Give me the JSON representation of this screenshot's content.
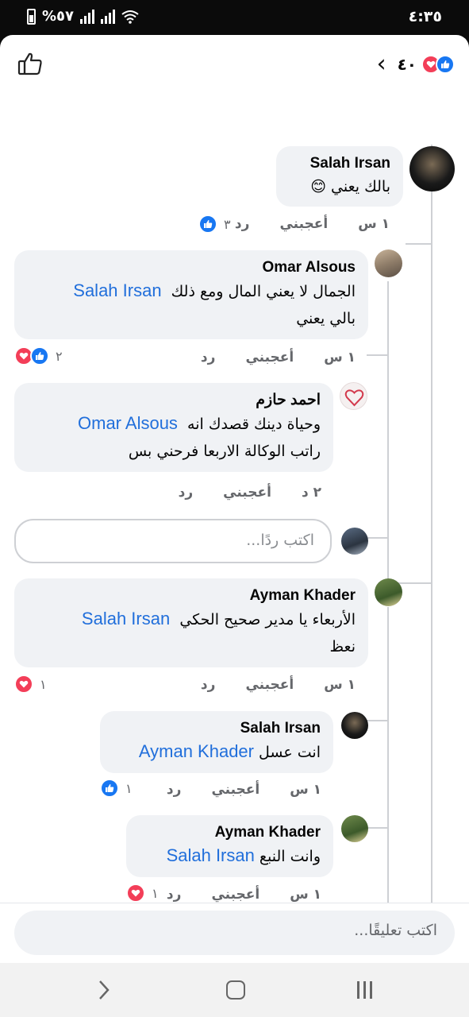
{
  "status_bar": {
    "time": "٤:٣٥",
    "battery": "%٥٧"
  },
  "header": {
    "reaction_count": "٤٠"
  },
  "comments": [
    {
      "author": "Salah Irsan",
      "text": "بالك يعني",
      "emoji": "😊",
      "time": "١ س",
      "like": "أعجبني",
      "reply": "رد",
      "reactions": "٣"
    },
    {
      "author": "Omar Alsous",
      "mention": "Salah Irsan",
      "text1": "الجمال لا يعني المال ومع ذلك",
      "text2": "بالي يعني",
      "time": "١ س",
      "like": "أعجبني",
      "reply": "رد",
      "reactions": "٢"
    },
    {
      "author": "احمد حازم",
      "mention": "Omar Alsous",
      "text1": "وحياة دينك قصدك انه",
      "text2": "راتب الوكالة الاربعا فرحني بس",
      "time": "٢ د",
      "like": "أعجبني",
      "reply": "رد"
    },
    {
      "author": "Ayman Khader",
      "mention": "Salah Irsan",
      "text1": "الأربعاء يا مدير صحيح الحكي",
      "text2": "نعظ",
      "time": "١ س",
      "like": "أعجبني",
      "reply": "رد",
      "reactions": "١"
    },
    {
      "author": "Salah Irsan",
      "mention": "Ayman Khader",
      "text1": "انت عسل",
      "time": "١ س",
      "like": "أعجبني",
      "reply": "رد",
      "reactions": "١"
    },
    {
      "author": "Ayman Khader",
      "mention": "Salah Irsan",
      "text1": "وانت النبع",
      "time": "١ س",
      "like": "أعجبني",
      "reply": "رد",
      "reactions": "١"
    }
  ],
  "reply_placeholder": "اكتب ردًا...",
  "comment_placeholder": "اكتب تعليقًا...",
  "colors": {
    "link": "#216fdb",
    "like": "#1877f2",
    "love": "#f33e58",
    "bubble": "#f0f2f5"
  }
}
